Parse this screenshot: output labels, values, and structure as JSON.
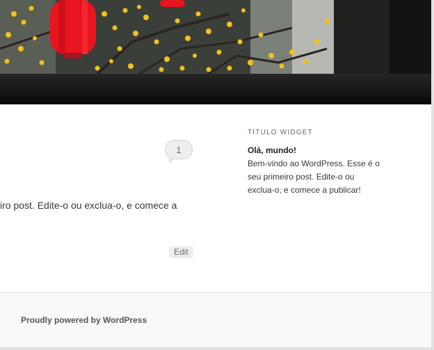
{
  "header": {
    "image": "lantern-and-yellow-blossoms-photo"
  },
  "nav": {},
  "post": {
    "comment_count": "1",
    "excerpt": "iro post. Edite-o ou exclua-o, e comece a",
    "edit_label": "Edit"
  },
  "sidebar": {
    "widget_title": "TÍTULO WIDGET",
    "post_title": "Olá, mundo!",
    "post_excerpt": "Bem-vindo ao WordPress. Esse é o seu primeiro post. Edite-o ou exclua-o, e comece a publicar!"
  },
  "footer": {
    "credit": "Proudly powered by WordPress"
  },
  "colors": {
    "nav_bar": "#111111",
    "lantern_red": "#e8141e",
    "blossom_yellow": "#f0c21a",
    "footer_bg": "#f9f9f9"
  }
}
